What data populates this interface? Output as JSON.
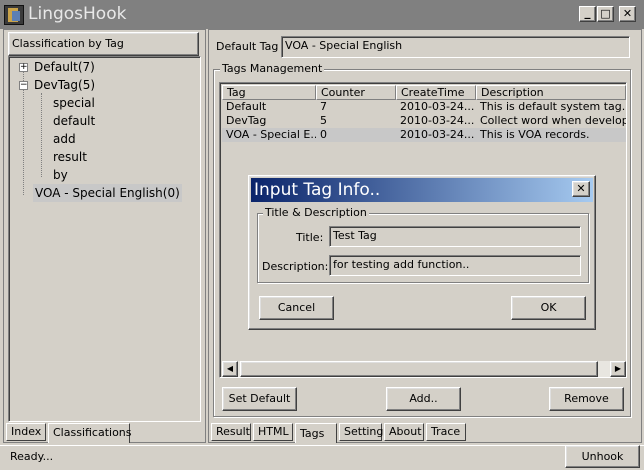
{
  "window": {
    "title": "LingosHook"
  },
  "titlebar_buttons": {
    "minimize": "_",
    "maximize": "□",
    "close": "✕"
  },
  "left_panel": {
    "header": "Classification by Tag",
    "tree": [
      {
        "label": "Default(7)",
        "expander": "+"
      },
      {
        "label": "DevTag(5)",
        "expander": "−"
      },
      {
        "label": "special"
      },
      {
        "label": "default"
      },
      {
        "label": "add"
      },
      {
        "label": "result"
      },
      {
        "label": "by"
      },
      {
        "label": "VOA - Special English(0)"
      }
    ],
    "tabs": [
      "Index",
      "Classifications"
    ]
  },
  "right_panel": {
    "default_tag_label": "Default Tag",
    "default_tag_value": "VOA - Special English",
    "tags_group_label": "Tags Management",
    "table": {
      "columns": [
        "Tag",
        "Counter",
        "CreateTime",
        "Description"
      ],
      "rows": [
        [
          "Default",
          "7",
          "2010-03-24...",
          "This is default system tag."
        ],
        [
          "DevTag",
          "5",
          "2010-03-24...",
          "Collect word when developing"
        ],
        [
          "VOA - Special E...",
          "0",
          "2010-03-24...",
          "This is VOA records."
        ]
      ]
    },
    "buttons": {
      "set_default": "Set Default",
      "add": "Add..",
      "remove": "Remove"
    },
    "tabs": [
      "Result",
      "HTML",
      "Tags",
      "Setting",
      "About",
      "Trace"
    ]
  },
  "dialog": {
    "title": "Input Tag Info..",
    "group_label": "Title & Description",
    "title_label": "Title:",
    "title_value": "Test Tag",
    "description_label": "Description:",
    "description_value": "for testing add function..",
    "cancel": "Cancel",
    "ok": "OK"
  },
  "statusbar": {
    "status": "Ready...",
    "unhook": "Unhook"
  },
  "scroll_arrows": {
    "left": "◀",
    "right": "▶"
  },
  "colors": {
    "dialog_title_start": "#0a246a",
    "dialog_title_end": "#a6caf0",
    "titlebar": "#808080",
    "face": "#d4d0c8"
  }
}
